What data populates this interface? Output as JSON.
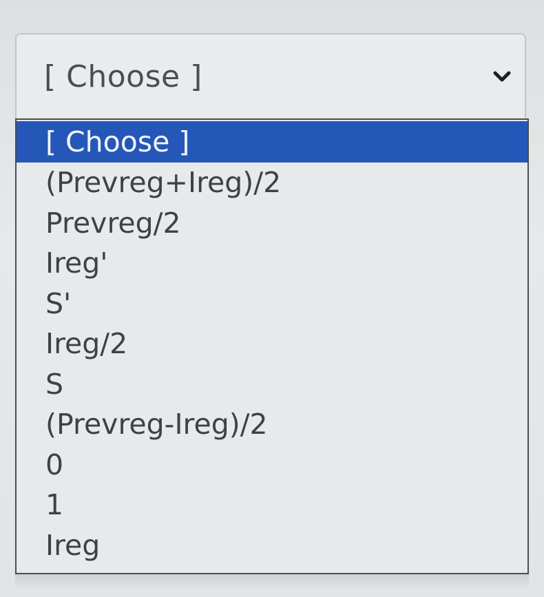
{
  "select": {
    "value": "[ Choose ]",
    "icon": "chevron-down-icon"
  },
  "options": [
    "[ Choose ]",
    "(Prevreg+Ireg)/2",
    "Prevreg/2",
    "Ireg'",
    "S'",
    "Ireg/2",
    "S",
    "(Prevreg-Ireg)/2",
    "0",
    "1",
    "Ireg"
  ],
  "selected_index": 0,
  "colors": {
    "highlight": "#2457b8",
    "highlight_text": "#f2f5fb",
    "text": "#3e4246",
    "list_border": "#4a4d52",
    "background": "#e7eaeb"
  }
}
